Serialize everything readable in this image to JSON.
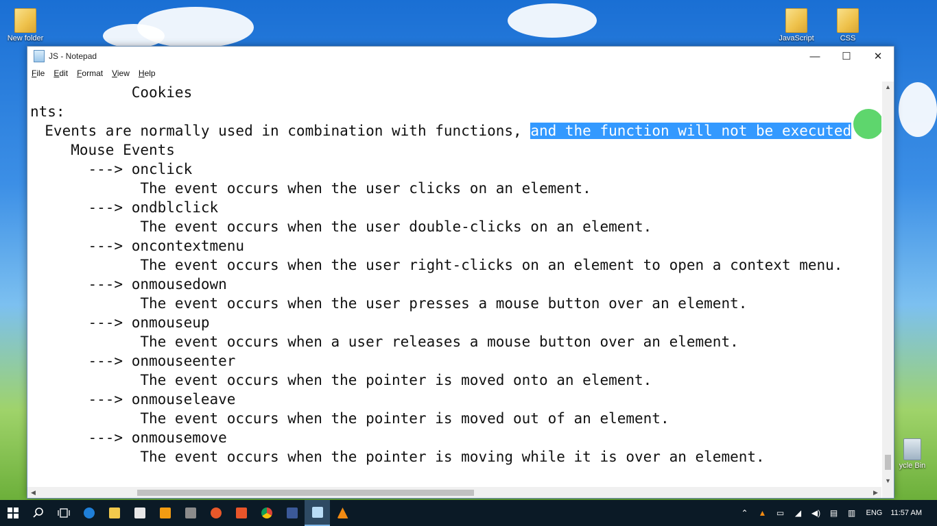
{
  "desktop": {
    "icons": [
      {
        "label": "New folder"
      },
      {
        "label": "JavaScript"
      },
      {
        "label": "CSS"
      },
      {
        "label": "ycle Bin"
      }
    ]
  },
  "window": {
    "title": "JS - Notepad",
    "buttons": {
      "minimize": "—",
      "maximize": "☐",
      "close": "✕"
    }
  },
  "menu": [
    "File",
    "Edit",
    "Format",
    "View",
    "Help"
  ],
  "editor": {
    "lines": [
      "            Cookies",
      "nts:",
      "  Events are normally used in combination with functions, ",
      "     Mouse Events",
      "       ---> onclick",
      "             The event occurs when the user clicks on an element.",
      "       ---> ondblclick",
      "             The event occurs when the user double-clicks on an element.",
      "       ---> oncontextmenu",
      "             The event occurs when the user right-clicks on an element to open a context menu.",
      "       ---> onmousedown",
      "             The event occurs when the user presses a mouse button over an element.",
      "       ---> onmouseup",
      "             The event occurs when a user releases a mouse button over an element.",
      "       ---> onmouseenter",
      "             The event occurs when the pointer is moved onto an element.",
      "       ---> onmouseleave",
      "             The event occurs when the pointer is moved out of an element.",
      "       ---> onmousemove",
      "             The event occurs when the pointer is moving while it is over an element."
    ],
    "selected_text": "and the function will not be executed"
  },
  "taskbar": {
    "language": "ENG",
    "time": "11:57 AM"
  }
}
